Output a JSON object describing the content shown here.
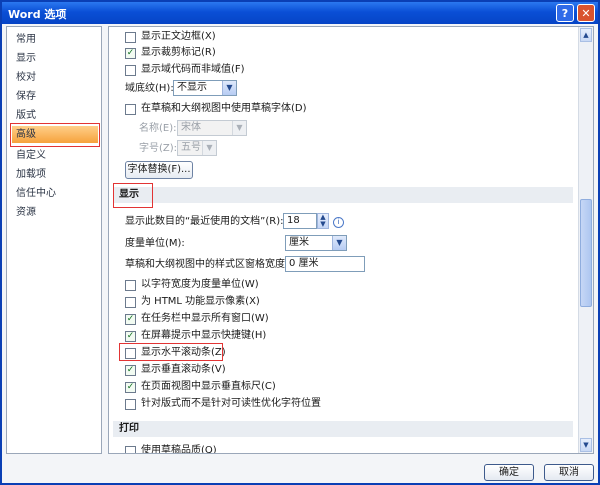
{
  "window": {
    "title": "Word 选项",
    "help_glyph": "?",
    "close_glyph": "✕"
  },
  "nav": {
    "items": [
      "常用",
      "显示",
      "校对",
      "保存",
      "版式",
      "高级",
      "自定义",
      "加载项",
      "信任中心",
      "资源"
    ],
    "active_index": 5
  },
  "top_options": {
    "show_text_boundaries": {
      "label": "显示正文边框(X)",
      "checked": false
    },
    "show_crop_marks": {
      "label": "显示裁剪标记(R)",
      "checked": true
    },
    "show_field_codes": {
      "label": "显示域代码而非域值(F)",
      "checked": false
    },
    "field_shading": {
      "label": "域底纹(H):",
      "value": "不显示"
    },
    "use_draft_font": {
      "label": "在草稿和大纲视图中使用草稿字体(D)",
      "checked": false
    },
    "font_name": {
      "label": "名称(E):",
      "value": "宋体"
    },
    "font_size": {
      "label": "字号(Z):",
      "value": "五号"
    },
    "font_substitution_button": "字体替换(F)..."
  },
  "display_section": {
    "header": "显示",
    "recent_docs": {
      "label": "显示此数目的“最近使用的文档”(R):",
      "value": "18"
    },
    "units": {
      "label": "度量单位(M):",
      "value": "厘米"
    },
    "style_area_width": {
      "label": "草稿和大纲视图中的样式区窗格宽度(E):",
      "value": "0 厘米"
    },
    "options": [
      {
        "label": "以字符宽度为度量单位(W)",
        "checked": false
      },
      {
        "label": "为 HTML 功能显示像素(X)",
        "checked": false
      },
      {
        "label": "在任务栏中显示所有窗口(W)",
        "checked": true
      },
      {
        "label": "在屏幕提示中显示快捷键(H)",
        "checked": true
      },
      {
        "label": "显示水平滚动条(Z)",
        "checked": false
      },
      {
        "label": "显示垂直滚动条(V)",
        "checked": true
      },
      {
        "label": "在页面视图中显示垂直标尺(C)",
        "checked": true
      },
      {
        "label": "针对版式而不是针对可读性优化字符位置",
        "checked": false
      }
    ]
  },
  "print_section": {
    "header": "打印",
    "use_draft_quality": {
      "label": "使用草稿品质(Q)",
      "checked": false
    }
  },
  "footer": {
    "ok_label": "确定",
    "cancel_label": "取消"
  },
  "colors": {
    "title_bar": "#0a4fd6",
    "active_nav": "#f6a23c",
    "highlight_box": "#e23434"
  }
}
